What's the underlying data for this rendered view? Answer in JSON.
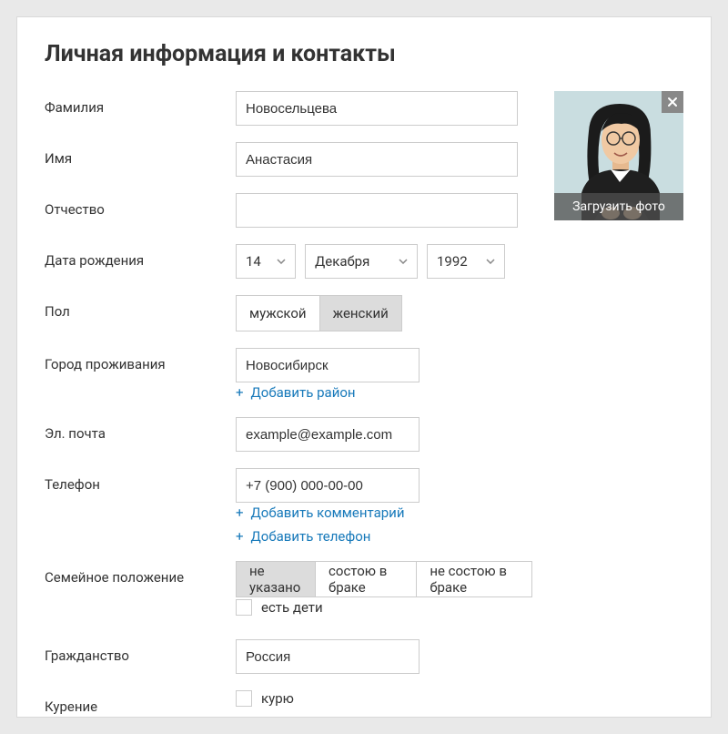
{
  "title": "Личная информация и контакты",
  "labels": {
    "surname": "Фамилия",
    "name": "Имя",
    "patronymic": "Отчество",
    "dob": "Дата рождения",
    "gender": "Пол",
    "city": "Город проживания",
    "email": "Эл. почта",
    "phone": "Телефон",
    "marital": "Семейное положение",
    "citizenship": "Гражданство",
    "smoking": "Курение"
  },
  "values": {
    "surname": "Новосельцева",
    "name": "Анастасия",
    "patronymic": "",
    "dob_day": "14",
    "dob_month": "Декабря",
    "dob_year": "1992",
    "city": "Новосибирск",
    "email": "example@example.com",
    "phone": "+7 (900) 000-00-00",
    "citizenship": "Россия"
  },
  "gender": {
    "options": [
      "мужской",
      "женский"
    ],
    "active_index": 1
  },
  "marital": {
    "options": [
      "не указано",
      "состою в браке",
      "не состою в браке"
    ],
    "active_index": 0,
    "children_label": "есть дети"
  },
  "links": {
    "add_district": "Добавить район",
    "add_comment": "Добавить комментарий",
    "add_phone": "Добавить телефон"
  },
  "smoking_label": "курю",
  "photo": {
    "upload_label": "Загрузить фото",
    "close_icon": "close-icon"
  }
}
